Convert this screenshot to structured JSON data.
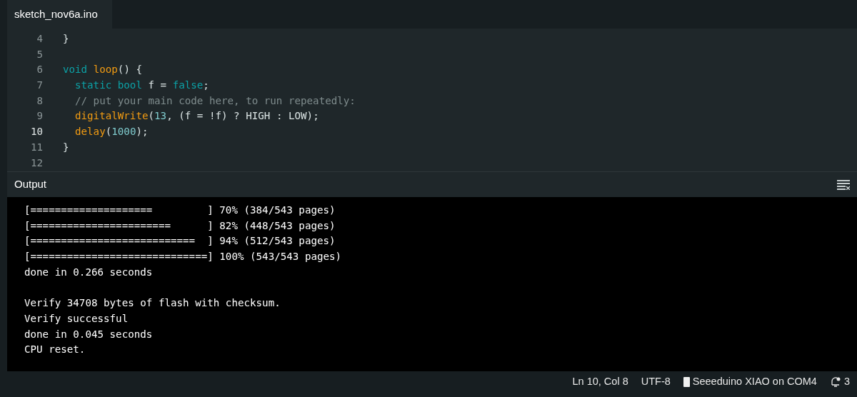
{
  "tabs": [
    {
      "label": "sketch_nov6a.ino",
      "selected": true
    }
  ],
  "editor": {
    "lines": [
      {
        "number": "4",
        "current": false,
        "indented": false,
        "tokens": [
          {
            "kind": "plain",
            "text": "}"
          }
        ]
      },
      {
        "number": "5",
        "current": false
      },
      {
        "number": "6",
        "current": false,
        "indented": false,
        "tokens": [
          {
            "kind": "keyword",
            "text": "void"
          },
          {
            "kind": "function",
            "text": "loop",
            "space_before": true
          },
          {
            "kind": "plain",
            "text": "() {"
          }
        ]
      },
      {
        "number": "7",
        "current": false,
        "indented": true,
        "tokens": [
          {
            "kind": "keyword",
            "text": "static bool"
          },
          {
            "kind": "plain",
            "text": "f =",
            "space_before": true
          },
          {
            "kind": "keyword",
            "text": "false",
            "space_before": true
          },
          {
            "kind": "plain",
            "text": ";"
          }
        ]
      },
      {
        "number": "8",
        "current": false,
        "indented": true,
        "tokens": [
          {
            "kind": "comment",
            "text": "// put your main code here, to run repeatedly:"
          }
        ]
      },
      {
        "number": "9",
        "current": false,
        "indented": true,
        "tokens": [
          {
            "kind": "function",
            "text": "digitalWrite"
          },
          {
            "kind": "plain",
            "text": "("
          },
          {
            "kind": "number",
            "text": "13"
          },
          {
            "kind": "plain",
            "text": ", (f = !f) ? HIGH : LOW);"
          }
        ]
      },
      {
        "number": "10",
        "current": true,
        "indented": true,
        "tokens": [
          {
            "kind": "function",
            "text": "delay"
          },
          {
            "kind": "plain",
            "text": "("
          },
          {
            "kind": "number",
            "text": "1000"
          },
          {
            "kind": "plain",
            "text": ");"
          }
        ]
      },
      {
        "number": "11",
        "current": false,
        "indented": false,
        "tokens": [
          {
            "kind": "plain",
            "text": "}"
          }
        ]
      },
      {
        "number": "12",
        "current": false
      }
    ]
  },
  "output": {
    "title": "Output",
    "blocks": [
      [
        "[====================         ] 70% (384/543 pages)",
        "[=======================      ] 82% (448/543 pages)",
        "[===========================  ] 94% (512/543 pages)",
        "[=============================] 100% (543/543 pages)",
        "done in 0.266 seconds"
      ],
      [
        "Verify 34708 bytes of flash with checksum.",
        "Verify successful",
        "done in 0.045 seconds",
        "CPU reset."
      ]
    ]
  },
  "status_bar": {
    "position": "Ln 10, Col 8",
    "encoding": "UTF-8",
    "board": "Seeeduino XIAO on COM4",
    "notifications": "3"
  }
}
